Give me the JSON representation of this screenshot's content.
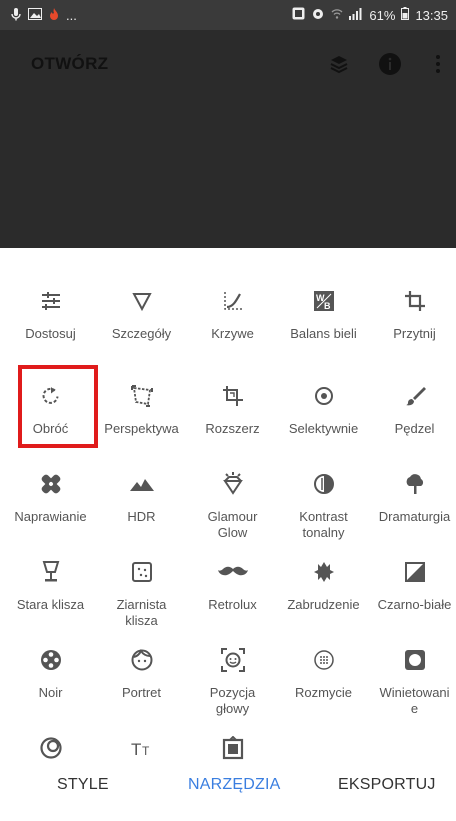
{
  "status": {
    "battery": "61%",
    "time": "13:35",
    "ellipsis": "..."
  },
  "appbar": {
    "open": "OTWÓRZ"
  },
  "tools": [
    {
      "label": "Dostosuj",
      "icon": "adjust-sliders-icon"
    },
    {
      "label": "Szczegóły",
      "icon": "details-triangle-icon"
    },
    {
      "label": "Krzywe",
      "icon": "curves-icon"
    },
    {
      "label": "Balans bieli",
      "icon": "white-balance-icon"
    },
    {
      "label": "Przytnij",
      "icon": "crop-icon"
    },
    {
      "label": "Obróć",
      "icon": "rotate-icon"
    },
    {
      "label": "Perspektywa",
      "icon": "perspective-icon"
    },
    {
      "label": "Rozszerz",
      "icon": "expand-icon"
    },
    {
      "label": "Selektywnie",
      "icon": "selective-icon"
    },
    {
      "label": "Pędzel",
      "icon": "brush-icon"
    },
    {
      "label": "Naprawianie",
      "icon": "healing-icon"
    },
    {
      "label": "HDR",
      "icon": "hdr-mountains-icon"
    },
    {
      "label": "Glamour\nGlow",
      "icon": "glamour-glow-icon"
    },
    {
      "label": "Kontrast\ntonalny",
      "icon": "tonal-contrast-icon"
    },
    {
      "label": "Dramaturgia",
      "icon": "drama-cloud-icon"
    },
    {
      "label": "Stara klisza",
      "icon": "vintage-lamp-icon"
    },
    {
      "label": "Ziarnista\nklisza",
      "icon": "grainy-film-icon"
    },
    {
      "label": "Retrolux",
      "icon": "retrolux-mustache-icon"
    },
    {
      "label": "Zabrudzenie",
      "icon": "grunge-icon"
    },
    {
      "label": "Czarno-białe",
      "icon": "black-white-icon"
    },
    {
      "label": "Noir",
      "icon": "noir-reel-icon"
    },
    {
      "label": "Portret",
      "icon": "portrait-face-icon"
    },
    {
      "label": "Pozycja\ngłowy",
      "icon": "head-pose-icon"
    },
    {
      "label": "Rozmycie",
      "icon": "blur-icon"
    },
    {
      "label": "Winietowani\ne",
      "icon": "vignette-icon"
    },
    {
      "label": "",
      "icon": "double-exposure-icon"
    },
    {
      "label": "",
      "icon": "text-icon"
    },
    {
      "label": "",
      "icon": "frames-icon"
    }
  ],
  "bottom_tabs": {
    "styles": "STYLE",
    "tools": "NARZĘDZIA",
    "export": "EKSPORTUJ"
  },
  "colors": {
    "accent": "#3a7ee0",
    "highlight": "#e01b1b"
  }
}
